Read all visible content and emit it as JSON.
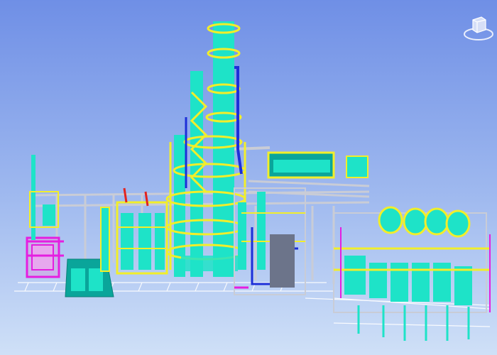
{
  "viewport": {
    "background_top": "#6f8fe6",
    "background_bottom": "#cfe0f7"
  },
  "colors": {
    "vessel": "#1ee3c8",
    "vessel_dark": "#0fb9a2",
    "platform": "#f2ee2a",
    "structure": "#c9ccd6",
    "structure_dark": "#8f95a6",
    "pipe_blue": "#1d2fd8",
    "pipe_magenta": "#e51ee0",
    "pipe_red": "#e3231e",
    "pipe_green": "#2fbf38",
    "skid_teal": "#0aa59a"
  },
  "viewcube": {
    "icon": "viewcube-icon",
    "label": ""
  }
}
